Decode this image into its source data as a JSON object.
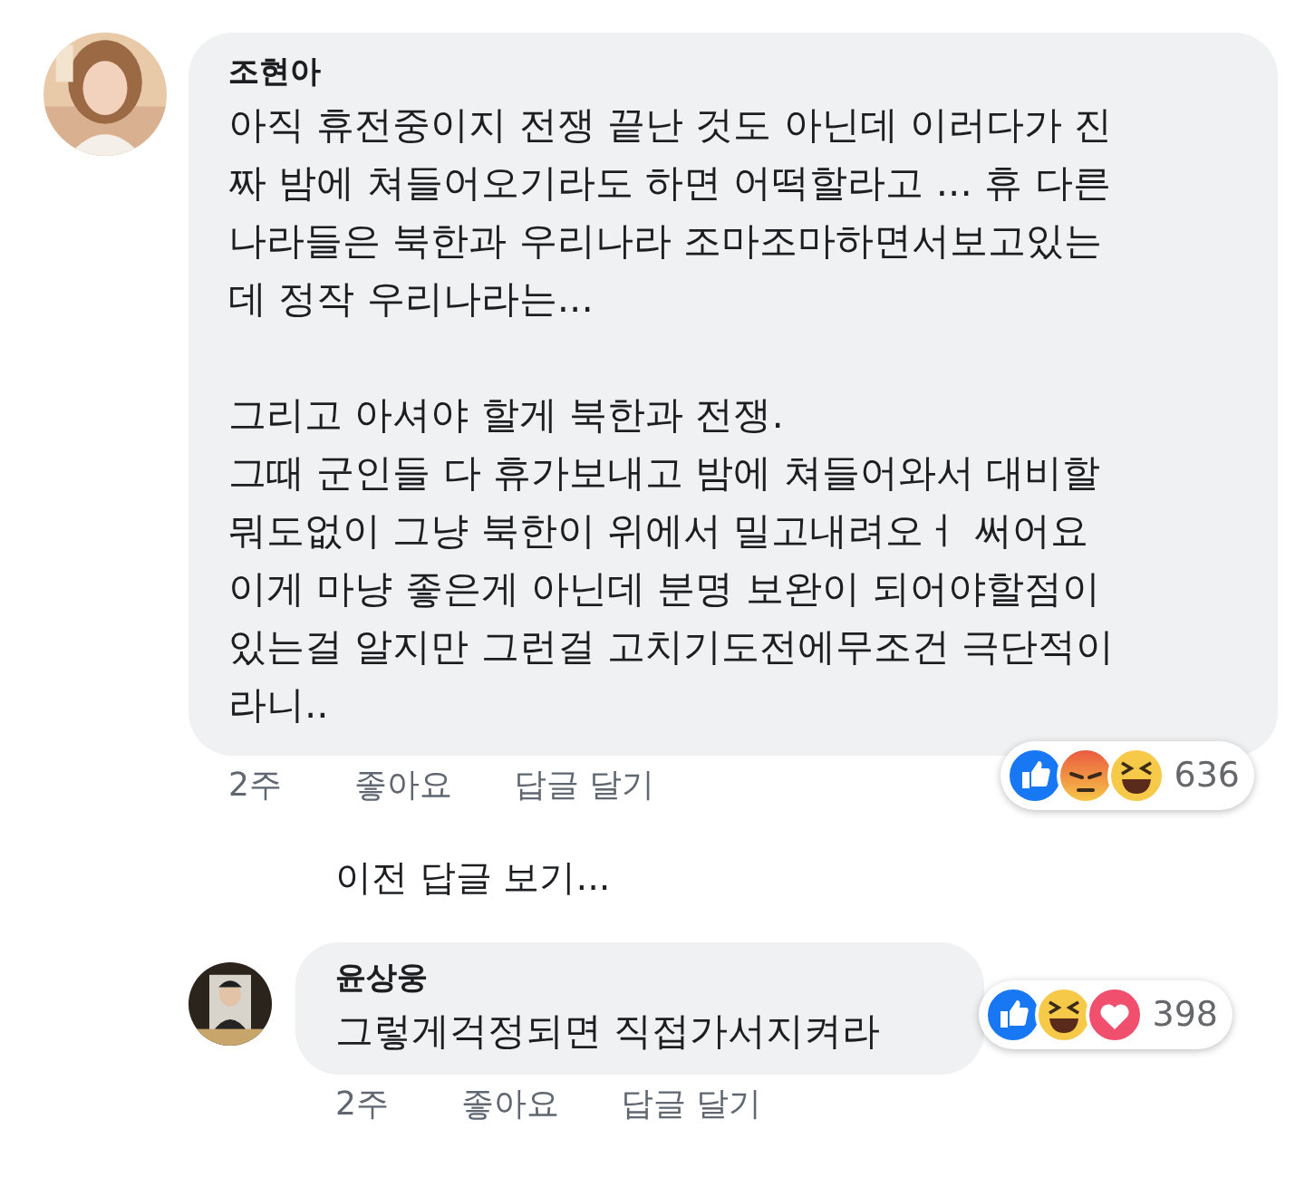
{
  "comment": {
    "avatar": {
      "kind": "picture"
    },
    "author": "조현아",
    "paragraphs": [
      [
        "아직 휴전중이지 전쟁 끝난 것도 아닌데 이러다가 진",
        "짜 밤에 쳐들어오기라도 하면 어떡할라고 ... 휴 다른",
        "나라들은 북한과 우리나라 조마조마하면서보고있는",
        "데 정작 우리나라는..."
      ],
      [
        "그리고 아셔야 할게 북한과 전쟁.",
        "그때 군인들 다 휴가보내고 밤에 쳐들어와서 대비할",
        "뭐도없이 그냥 북한이 위에서 밀고내려오ㅓ 써어요",
        "이게 마냥 좋은게 아닌데  분명 보완이 되어야할점이",
        "있는걸 알지만 그런걸 고치기도전에무조건 극단적이",
        "라니.."
      ]
    ],
    "reactions": [
      {
        "kind": "like"
      },
      {
        "kind": "angry"
      },
      {
        "kind": "haha"
      }
    ],
    "reaction_count": "636",
    "time": "2주",
    "like": "좋아요",
    "reply": "답글 달기"
  },
  "more_replies": "이전 답글 보기...",
  "reply": {
    "avatar": {
      "kind": "picture"
    },
    "author": "윤상웅",
    "paragraphs": [
      [
        "그렇게걱정되면 직접가서지켜라"
      ]
    ],
    "reactions": [
      {
        "kind": "like"
      },
      {
        "kind": "haha"
      },
      {
        "kind": "love"
      }
    ],
    "reaction_count": "398",
    "time": "2주",
    "like": "좋아요",
    "reply": "답글 달기"
  }
}
